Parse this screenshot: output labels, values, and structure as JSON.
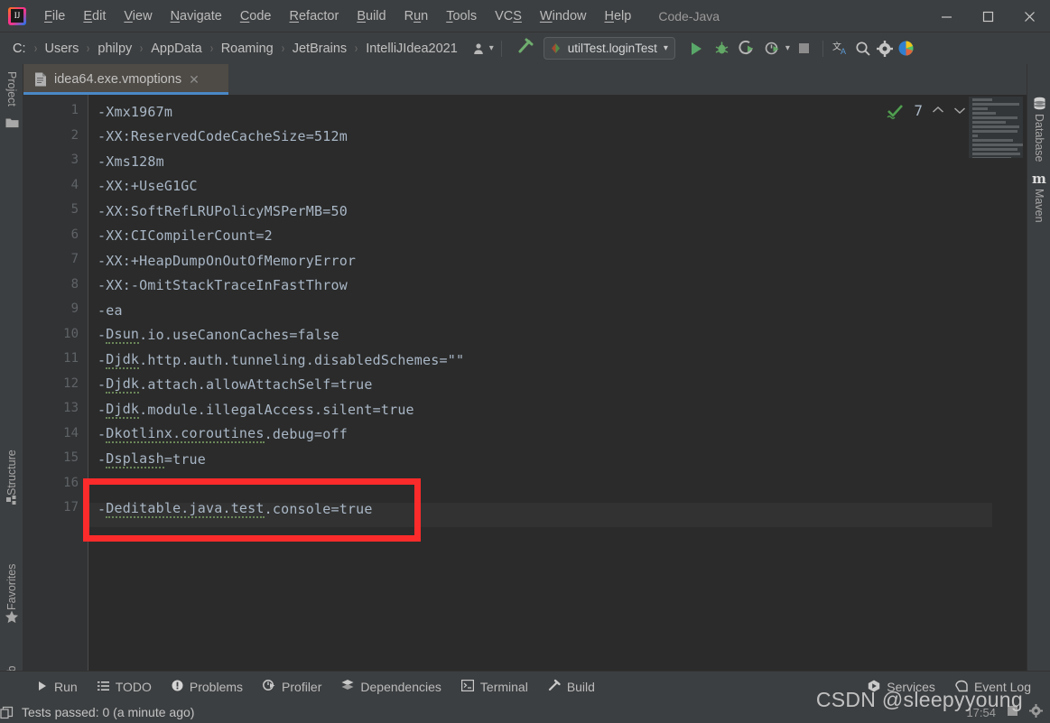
{
  "window": {
    "title": "Code-Java",
    "minimize_label": "–",
    "maximize_label": "☐",
    "close_label": "✕"
  },
  "menu": {
    "items": [
      {
        "label": "File",
        "mnemonic": "F"
      },
      {
        "label": "Edit",
        "mnemonic": "E"
      },
      {
        "label": "View",
        "mnemonic": "V"
      },
      {
        "label": "Navigate",
        "mnemonic": "N"
      },
      {
        "label": "Code",
        "mnemonic": "C"
      },
      {
        "label": "Refactor",
        "mnemonic": "R"
      },
      {
        "label": "Build",
        "mnemonic": "B"
      },
      {
        "label": "Run",
        "mnemonic": "u"
      },
      {
        "label": "Tools",
        "mnemonic": "T"
      },
      {
        "label": "VCS",
        "mnemonic": "S"
      },
      {
        "label": "Window",
        "mnemonic": "W"
      },
      {
        "label": "Help",
        "mnemonic": "H"
      }
    ]
  },
  "navbar": {
    "breadcrumbs": [
      "C:",
      "Users",
      "philpy",
      "AppData",
      "Roaming",
      "JetBrains",
      "IntelliJIdea2021"
    ],
    "separator": "›",
    "run_config": "utilTest.loginTest",
    "run_config_dropdown": "▾"
  },
  "toolbar": {
    "icons": [
      "user-dropdown-icon",
      "build-hammer-icon",
      "run-icon",
      "debug-icon",
      "run-coverage-icon",
      "profiler-icon",
      "stop-icon",
      "translate-icon",
      "search-icon",
      "settings-icon",
      "ide-help-icon"
    ]
  },
  "left_strip": {
    "items": [
      {
        "label": "Project",
        "icon": "project-icon"
      },
      {
        "label": "Structure",
        "icon": "structure-icon"
      },
      {
        "label": "Favorites",
        "icon": "star-icon"
      },
      {
        "label": "Web",
        "icon": "web-icon"
      }
    ]
  },
  "right_strip": {
    "items": [
      {
        "label": "Database",
        "icon": "database-icon"
      },
      {
        "label": "Maven",
        "icon": "maven-icon"
      }
    ]
  },
  "editor": {
    "tab": {
      "label": "idea64.exe.vmoptions",
      "icon": "file-icon",
      "close": "✕"
    },
    "inspection": {
      "status_icon": "inspection-ok-icon",
      "count": "7",
      "prev": "⌃",
      "next": "⌄"
    },
    "lines": [
      {
        "n": "1",
        "text": "-Xmx1967m",
        "typo": ""
      },
      {
        "n": "2",
        "text": "-XX:ReservedCodeCacheSize=512m",
        "typo": ""
      },
      {
        "n": "3",
        "text": "-Xms128m",
        "typo": ""
      },
      {
        "n": "4",
        "text": "-XX:+UseG1GC",
        "typo": ""
      },
      {
        "n": "5",
        "text": "-XX:SoftRefLRUPolicyMSPerMB=50",
        "typo": ""
      },
      {
        "n": "6",
        "text": "-XX:CICompilerCount=2",
        "typo": ""
      },
      {
        "n": "7",
        "text": "-XX:+HeapDumpOnOutOfMemoryError",
        "typo": ""
      },
      {
        "n": "8",
        "text": "-XX:-OmitStackTraceInFastThrow",
        "typo": ""
      },
      {
        "n": "9",
        "text": "-ea",
        "typo": ""
      },
      {
        "n": "10",
        "text": "-Dsun.io.useCanonCaches=false",
        "typo": "Dsun"
      },
      {
        "n": "11",
        "text": "-Djdk.http.auth.tunneling.disabledSchemes=\"\"",
        "typo": "Djdk"
      },
      {
        "n": "12",
        "text": "-Djdk.attach.allowAttachSelf=true",
        "typo": "Djdk"
      },
      {
        "n": "13",
        "text": "-Djdk.module.illegalAccess.silent=true",
        "typo": "Djdk"
      },
      {
        "n": "14",
        "text": "-Dkotlinx.coroutines.debug=off",
        "typo": "Dkotlinx.coroutines"
      },
      {
        "n": "15",
        "text": "-Dsplash=true",
        "typo": "Dsplash"
      },
      {
        "n": "16",
        "text": "",
        "typo": ""
      },
      {
        "n": "17",
        "text": "-Deditable.java.test.console=true",
        "typo": "Deditable.java.test"
      }
    ],
    "highlighted_line": "17",
    "annotation_color": "#fc2b2b"
  },
  "bottom_bar": {
    "items": [
      {
        "label": "Run",
        "icon": "run-icon"
      },
      {
        "label": "TODO",
        "icon": "todo-list-icon"
      },
      {
        "label": "Problems",
        "icon": "problems-icon"
      },
      {
        "label": "Profiler",
        "icon": "profiler-icon"
      },
      {
        "label": "Dependencies",
        "icon": "dependencies-icon"
      },
      {
        "label": "Terminal",
        "icon": "terminal-icon"
      },
      {
        "label": "Build",
        "icon": "build-hammer-icon"
      }
    ],
    "right_items": [
      {
        "label": "Services",
        "icon": "services-icon"
      },
      {
        "label": "Event Log",
        "icon": "event-log-icon"
      }
    ]
  },
  "status_bar": {
    "icon": "console-icon",
    "text": "Tests passed: 0 (a minute ago)"
  },
  "watermark": {
    "text": "CSDN @sleepyyoung"
  },
  "colors": {
    "chrome": "#3c3f41",
    "editor_bg": "#2b2b2b",
    "gutter_bg": "#313335",
    "code_text": "#a9b7c6",
    "tab_active": "#4e4a45",
    "tab_underline": "#4a88c7",
    "annotation_red": "#fc2b2b",
    "run_green": "#59a869",
    "typo_green": "#6a8759"
  }
}
